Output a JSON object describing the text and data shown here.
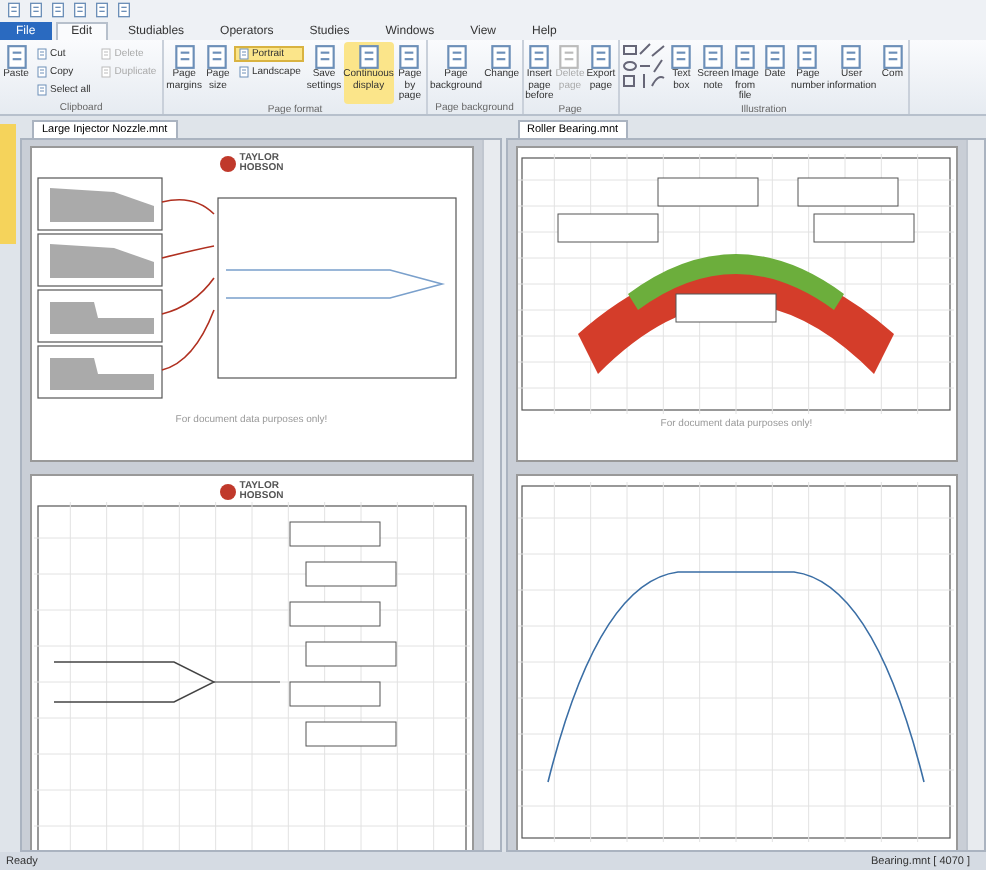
{
  "ribbon_tabs": [
    {
      "label": "File",
      "kind": "file",
      "selected": false
    },
    {
      "label": "Edit",
      "kind": "tab",
      "selected": true
    },
    {
      "label": "Studiables",
      "kind": "tab",
      "selected": false
    },
    {
      "label": "Operators",
      "kind": "tab",
      "selected": false
    },
    {
      "label": "Studies",
      "kind": "tab",
      "selected": false
    },
    {
      "label": "Windows",
      "kind": "tab",
      "selected": false
    },
    {
      "label": "View",
      "kind": "tab",
      "selected": false
    },
    {
      "label": "Help",
      "kind": "tab",
      "selected": false
    }
  ],
  "ribbon_groups": [
    {
      "label": "Clipboard",
      "buttons": [
        {
          "label": "Paste",
          "kind": "large",
          "selected": false,
          "disabled": false
        },
        {
          "label": "Cut",
          "kind": "small",
          "selected": false,
          "disabled": false
        },
        {
          "label": "Copy",
          "kind": "small",
          "selected": false,
          "disabled": false
        },
        {
          "label": "Select all",
          "kind": "small",
          "selected": false,
          "disabled": false
        },
        {
          "label": "Delete",
          "kind": "small",
          "selected": false,
          "disabled": true
        },
        {
          "label": "Duplicate",
          "kind": "small",
          "selected": false,
          "disabled": true
        }
      ]
    },
    {
      "label": "Page format",
      "buttons": [
        {
          "label": "Page margins",
          "kind": "large",
          "selected": false,
          "disabled": false
        },
        {
          "label": "Page size",
          "kind": "large",
          "selected": false,
          "disabled": false
        },
        {
          "label": "Portrait",
          "kind": "small",
          "selected": true,
          "disabled": false
        },
        {
          "label": "Landscape",
          "kind": "small",
          "selected": false,
          "disabled": false
        },
        {
          "label": "Save settings",
          "kind": "large",
          "selected": false,
          "disabled": false
        },
        {
          "label": "Continuous display",
          "kind": "large",
          "selected": true,
          "disabled": false
        },
        {
          "label": "Page by page",
          "kind": "large",
          "selected": false,
          "disabled": false
        }
      ]
    },
    {
      "label": "Page background",
      "buttons": [
        {
          "label": "Page background",
          "kind": "large",
          "selected": false,
          "disabled": false
        },
        {
          "label": "Change",
          "kind": "large",
          "selected": false,
          "disabled": false
        }
      ]
    },
    {
      "label": "Page",
      "buttons": [
        {
          "label": "Insert page before",
          "kind": "large",
          "selected": false,
          "disabled": false
        },
        {
          "label": "Delete page",
          "kind": "large",
          "selected": false,
          "disabled": true
        },
        {
          "label": "Export page",
          "kind": "large",
          "selected": false,
          "disabled": false
        }
      ]
    },
    {
      "label": "Illustration",
      "buttons": [
        {
          "label": "Text box",
          "kind": "large",
          "selected": false,
          "disabled": false
        },
        {
          "label": "Screen note",
          "kind": "large",
          "selected": false,
          "disabled": false
        },
        {
          "label": "Image from file",
          "kind": "large",
          "selected": false,
          "disabled": false
        },
        {
          "label": "Date",
          "kind": "large",
          "selected": false,
          "disabled": false
        },
        {
          "label": "Page number",
          "kind": "large",
          "selected": false,
          "disabled": false
        },
        {
          "label": "User information",
          "kind": "large",
          "selected": false,
          "disabled": false
        },
        {
          "label": "Com",
          "kind": "large",
          "selected": false,
          "disabled": false
        }
      ]
    }
  ],
  "panes": [
    {
      "tab": "Large Injector Nozzle.mnt",
      "pages": [
        {
          "kind": "nozzle",
          "logo_top": "TAYLOR",
          "logo_bottom": "HOBSON",
          "footer": "For document data purposes only!"
        },
        {
          "kind": "injector",
          "logo_top": "TAYLOR",
          "logo_bottom": "HOBSON"
        }
      ]
    },
    {
      "tab": "Roller Bearing.mnt",
      "pages": [
        {
          "kind": "bearing",
          "footer": "For document data purposes only!"
        },
        {
          "kind": "profile"
        }
      ]
    }
  ],
  "status_bar": {
    "left": "Ready",
    "right": "Bearing.mnt [ 4070 ]"
  }
}
